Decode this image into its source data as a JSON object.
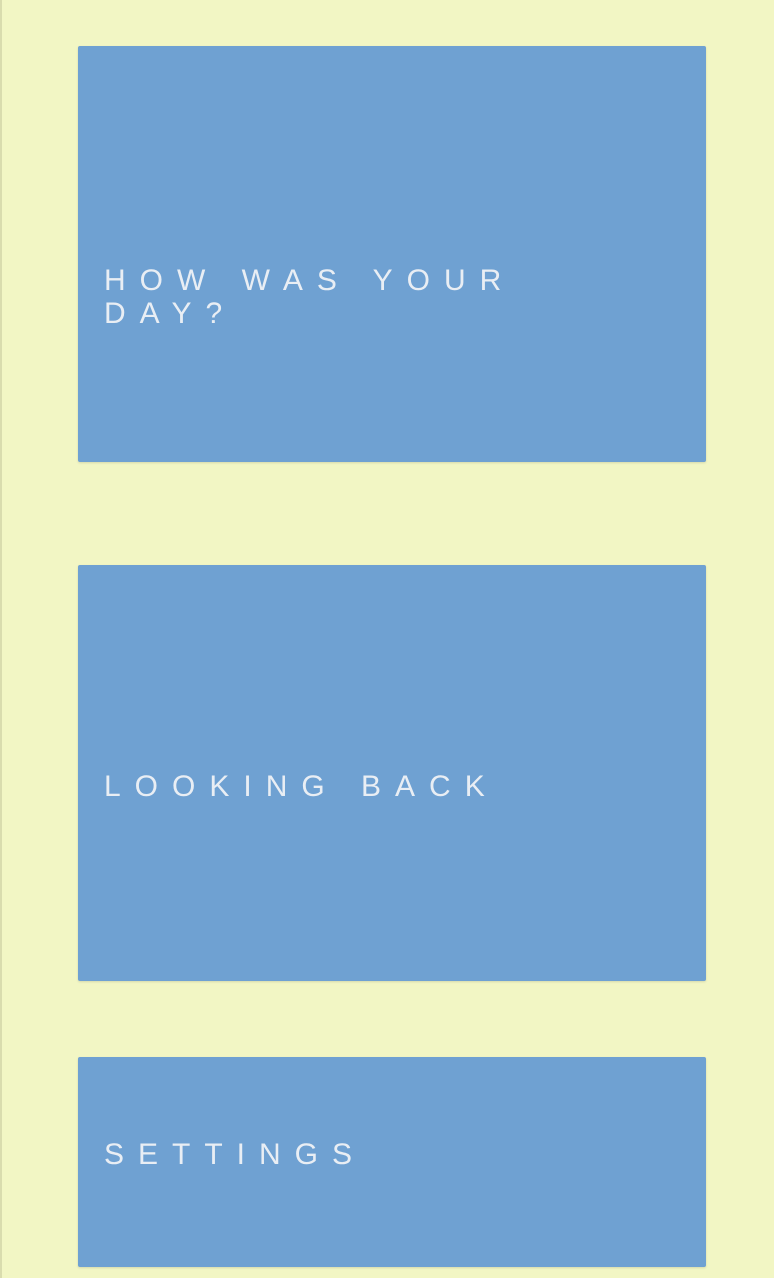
{
  "menu": {
    "items": [
      {
        "label": "HOW WAS YOUR DAY?"
      },
      {
        "label": "LOOKING BACK"
      },
      {
        "label": "SETTINGS"
      }
    ]
  },
  "colors": {
    "background": "#f2f6c4",
    "tile": "#6fa1d2",
    "tile_text": "#e9eef4"
  }
}
